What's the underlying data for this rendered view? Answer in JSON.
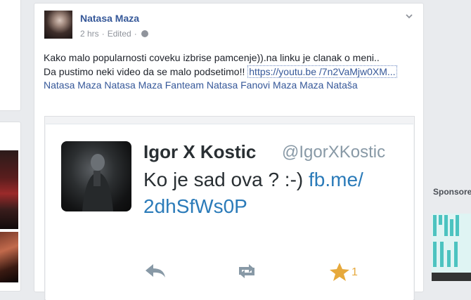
{
  "post": {
    "author": "Natasa Maza",
    "time": "2 hrs",
    "separator": "·",
    "edited": "Edited",
    "separator2": "·",
    "text_line1": "Kako malo popularnosti coveku izbrise pamcenje)).na linku je clanak o meni..",
    "text_line2": "Da pustimo neki video da se malo podsetimo!! ",
    "link_part1": "https://youtu.be",
    "link_part2": "/7n2VaMjw0XM...",
    "tags": " Natasa Maza Natasa Maza Fanteam Natasa Fanovi Maza Maza Nataša"
  },
  "tweet": {
    "name": "Igor X Kostic",
    "handle": "@IgorXKostic",
    "text": "Ko je sad ova ? :-) ",
    "link": "fb.me/ 2dhSfWs0P",
    "favorite_count": "1"
  },
  "sidebar": {
    "sponsored_label": "Sponsore"
  },
  "colors": {
    "link": "#365899",
    "tweet_link": "#2b7bb9",
    "favorite": "#e6a93c"
  }
}
